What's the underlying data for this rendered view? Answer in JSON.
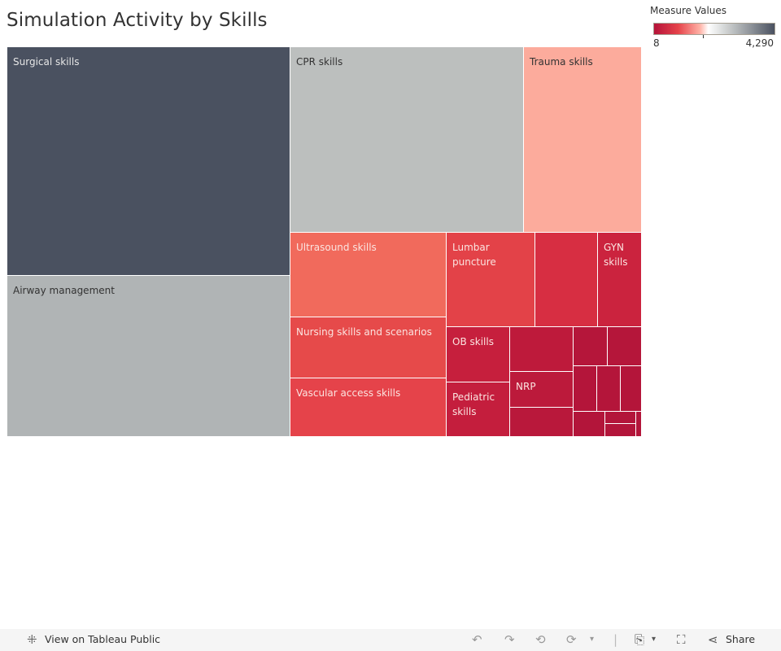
{
  "title": "Simulation Activity by Skills",
  "legend": {
    "title": "Measure Values",
    "min_label": "8",
    "max_label": "4,290"
  },
  "chart_data": {
    "type": "treemap",
    "title": "Simulation Activity by Skills",
    "color_measure": "Measure Values",
    "color_range": [
      8,
      4290
    ],
    "color_scale": [
      "#b5133a",
      "#e5434a",
      "#ffb1a5",
      "#ffffff",
      "#c9cccc",
      "#4a5160"
    ],
    "items": [
      {
        "label": "Surgical skills",
        "size": 4290,
        "color": "#4a5160",
        "text": "#e6e6e6"
      },
      {
        "label": "Airway management",
        "size": 2370,
        "color": "#b0b4b5",
        "text": "#333"
      },
      {
        "label": "CPR skills",
        "size": 2080,
        "color": "#bcbfbe",
        "text": "#333"
      },
      {
        "label": "Trauma skills",
        "size": 1050,
        "color": "#fcab9c",
        "text": "#333"
      },
      {
        "label": "Ultrasound skills",
        "size": 640,
        "color": "#f16a5c",
        "text": "#fbe4e0"
      },
      {
        "label": "Nursing skills and scenarios",
        "size": 460,
        "color": "#e64a4a",
        "text": "#fbe4e0"
      },
      {
        "label": "Vascular access skills",
        "size": 440,
        "color": "#e5434a",
        "text": "#fbe4e0"
      },
      {
        "label": "Lumbar\npuncture",
        "size": 390,
        "color": "#e34248",
        "text": "#fbe4e0"
      },
      {
        "label": "",
        "size": 270,
        "color": "#d72e42",
        "text": "#fbe4e0"
      },
      {
        "label": "GYN\nskills",
        "size": 195,
        "color": "#cb233e",
        "text": "#fbe4e0"
      },
      {
        "label": "OB skills",
        "size": 180,
        "color": "#c61f3d",
        "text": "#fbe4e0"
      },
      {
        "label": "Pediatric\nskills",
        "size": 170,
        "color": "#c41e3d",
        "text": "#fbe4e0"
      },
      {
        "label": "",
        "size": 150,
        "color": "#be1a3b",
        "text": "#fbe4e0"
      },
      {
        "label": "NRP",
        "size": 115,
        "color": "#bc1a3b",
        "text": "#fbe4e0"
      },
      {
        "label": "",
        "size": 95,
        "color": "#b9183b",
        "text": "#fbe4e0"
      },
      {
        "label": "",
        "size": 70,
        "color": "#b5163a",
        "text": "#fbe4e0"
      },
      {
        "label": "",
        "size": 70,
        "color": "#b5163a",
        "text": "#fbe4e0"
      },
      {
        "label": "",
        "size": 52,
        "color": "#b4153a",
        "text": "#fbe4e0"
      },
      {
        "label": "",
        "size": 52,
        "color": "#b4153a",
        "text": "#fbe4e0"
      },
      {
        "label": "",
        "size": 45,
        "color": "#b4153a",
        "text": "#fbe4e0"
      },
      {
        "label": "",
        "size": 40,
        "color": "#b3153a",
        "text": "#fbe4e0"
      },
      {
        "label": "",
        "size": 22,
        "color": "#b3153a",
        "text": "#fbe4e0"
      },
      {
        "label": "",
        "size": 25,
        "color": "#b3153a",
        "text": "#fbe4e0"
      },
      {
        "label": "",
        "size": 8,
        "color": "#b3153a",
        "text": "#fbe4e0"
      }
    ]
  },
  "footer": {
    "view_label": "View on Tableau Public",
    "share_label": "Share"
  }
}
